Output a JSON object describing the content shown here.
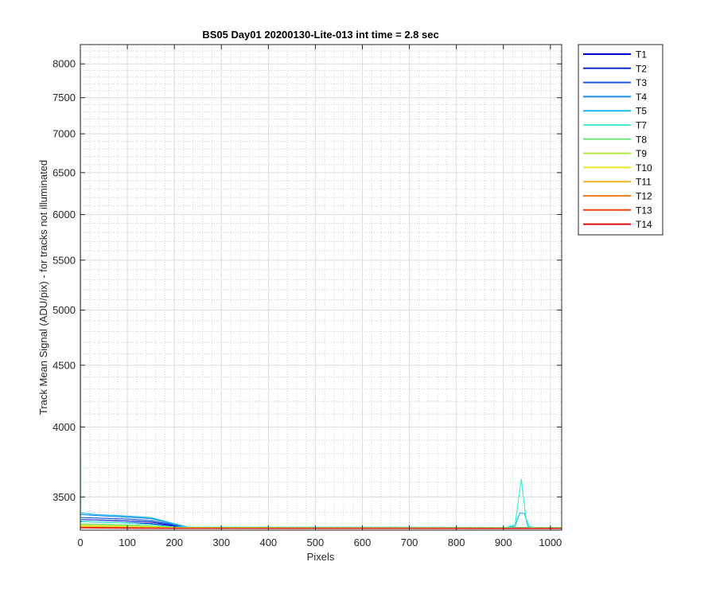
{
  "chart_data": {
    "type": "line",
    "title": "BS05 Day01 20200130-Lite-013 int time = 2.8 sec",
    "xlabel": "Pixels",
    "ylabel": "Track Mean Signal (ADU/pix) - for tracks not illuminated",
    "xlim": [
      0,
      1024
    ],
    "ylim": [
      3285,
      8300
    ],
    "y_scale": "log",
    "grid": true,
    "minor_grid": true,
    "legend_position": "outside-top-right",
    "x_ticks": [
      0,
      100,
      200,
      300,
      400,
      500,
      600,
      700,
      800,
      900,
      1000
    ],
    "y_ticks": [
      3500,
      4000,
      4500,
      5000,
      5500,
      6000,
      6500,
      7000,
      7500,
      8000
    ],
    "series": [
      {
        "name": "T1",
        "color": "#0000c8",
        "points": [
          [
            0,
            3340
          ],
          [
            50,
            3336
          ],
          [
            100,
            3332
          ],
          [
            150,
            3326
          ],
          [
            200,
            3310
          ],
          [
            230,
            3300
          ],
          [
            1024,
            3299
          ]
        ]
      },
      {
        "name": "T2",
        "color": "#0a2ad6",
        "points": [
          [
            0,
            3352
          ],
          [
            50,
            3348
          ],
          [
            100,
            3343
          ],
          [
            150,
            3336
          ],
          [
            200,
            3315
          ],
          [
            230,
            3301
          ],
          [
            1024,
            3300
          ]
        ]
      },
      {
        "name": "T3",
        "color": "#1a5ae6",
        "points": [
          [
            0,
            3365
          ],
          [
            50,
            3360
          ],
          [
            100,
            3355
          ],
          [
            150,
            3345
          ],
          [
            200,
            3318
          ],
          [
            230,
            3302
          ],
          [
            1024,
            3301
          ]
        ]
      },
      {
        "name": "T4",
        "color": "#1a8cf0",
        "points": [
          [
            0,
            3385
          ],
          [
            50,
            3375
          ],
          [
            100,
            3368
          ],
          [
            150,
            3358
          ],
          [
            200,
            3322
          ],
          [
            230,
            3303
          ],
          [
            1024,
            3302
          ]
        ]
      },
      {
        "name": "T5",
        "color": "#1abcf0",
        "points": [
          [
            0,
            3395
          ],
          [
            30,
            3385
          ],
          [
            100,
            3375
          ],
          [
            150,
            3365
          ],
          [
            200,
            3325
          ],
          [
            230,
            3304
          ],
          [
            905,
            3302
          ],
          [
            925,
            3310
          ],
          [
            935,
            3395
          ],
          [
            945,
            3390
          ],
          [
            952,
            3310
          ],
          [
            965,
            3301
          ],
          [
            1024,
            3301
          ]
        ]
      },
      {
        "name": "T7",
        "color": "#40f0d0",
        "points": [
          [
            0,
            8300
          ],
          [
            1,
            3360
          ],
          [
            3,
            3340
          ],
          [
            50,
            3336
          ],
          [
            100,
            3330
          ],
          [
            150,
            3320
          ],
          [
            200,
            3305
          ],
          [
            905,
            3302
          ],
          [
            925,
            3320
          ],
          [
            938,
            3620
          ],
          [
            948,
            3360
          ],
          [
            955,
            3310
          ],
          [
            968,
            3301
          ],
          [
            1024,
            3301
          ]
        ]
      },
      {
        "name": "T8",
        "color": "#70e880",
        "points": [
          [
            0,
            3325
          ],
          [
            50,
            3322
          ],
          [
            100,
            3318
          ],
          [
            150,
            3312
          ],
          [
            200,
            3302
          ],
          [
            1024,
            3300
          ]
        ]
      },
      {
        "name": "T9",
        "color": "#b0e840",
        "points": [
          [
            0,
            3318
          ],
          [
            50,
            3315
          ],
          [
            100,
            3312
          ],
          [
            150,
            3308
          ],
          [
            200,
            3301
          ],
          [
            1024,
            3299
          ]
        ]
      },
      {
        "name": "T10",
        "color": "#e8e820",
        "points": [
          [
            0,
            3312
          ],
          [
            50,
            3310
          ],
          [
            100,
            3307
          ],
          [
            150,
            3304
          ],
          [
            200,
            3300
          ],
          [
            1024,
            3298
          ]
        ]
      },
      {
        "name": "T11",
        "color": "#f0b020",
        "points": [
          [
            0,
            3306
          ],
          [
            100,
            3303
          ],
          [
            200,
            3299
          ],
          [
            1024,
            3297
          ]
        ]
      },
      {
        "name": "T12",
        "color": "#f08020",
        "points": [
          [
            0,
            3303
          ],
          [
            100,
            3301
          ],
          [
            200,
            3298
          ],
          [
            1024,
            3297
          ]
        ]
      },
      {
        "name": "T13",
        "color": "#f04010",
        "points": [
          [
            0,
            3301
          ],
          [
            100,
            3299
          ],
          [
            200,
            3297
          ],
          [
            1024,
            3296
          ]
        ]
      },
      {
        "name": "T14",
        "color": "#e01010",
        "points": [
          [
            0,
            3299
          ],
          [
            100,
            3297
          ],
          [
            200,
            3296
          ],
          [
            1024,
            3295
          ]
        ]
      }
    ]
  }
}
